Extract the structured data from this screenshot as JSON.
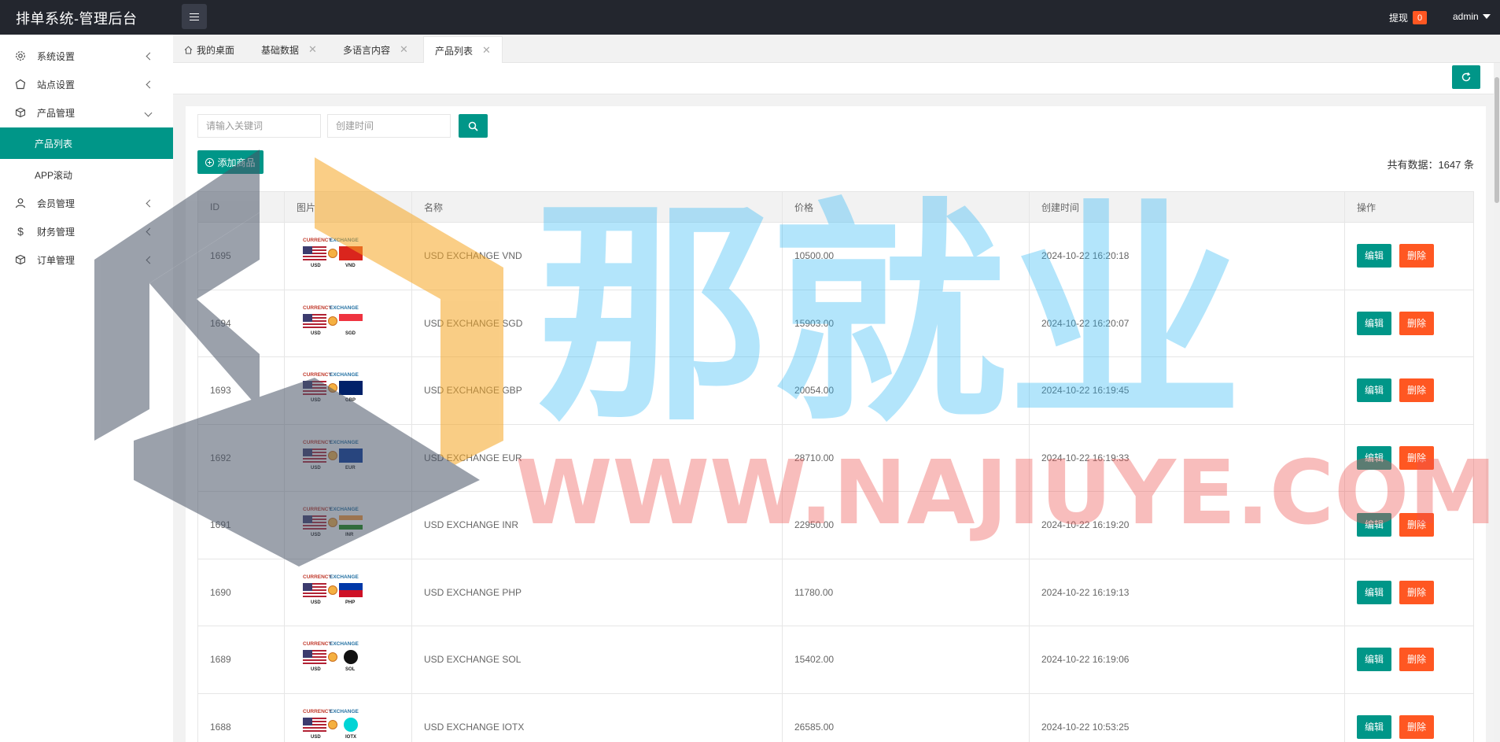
{
  "header": {
    "title": "排单系统-管理后台",
    "withdraw_label": "提现",
    "withdraw_count": "0",
    "user_name": "admin"
  },
  "sidebar": {
    "items": [
      {
        "label": "系统设置",
        "icon": "gear-icon"
      },
      {
        "label": "站点设置",
        "icon": "site-icon"
      },
      {
        "label": "产品管理",
        "icon": "box-icon"
      },
      {
        "label": "会员管理",
        "icon": "user-icon"
      },
      {
        "label": "财务管理",
        "icon": "dollar-icon"
      },
      {
        "label": "订单管理",
        "icon": "order-icon"
      }
    ],
    "sub_items": [
      {
        "label": "产品列表",
        "active": true
      },
      {
        "label": "APP滚动",
        "active": false
      }
    ]
  },
  "tabs": [
    {
      "label": "我的桌面",
      "closable": false
    },
    {
      "label": "基础数据",
      "closable": true
    },
    {
      "label": "多语言内容",
      "closable": true
    },
    {
      "label": "产品列表",
      "closable": true,
      "active": true
    }
  ],
  "filters": {
    "keyword_placeholder": "请输入关键词",
    "date_placeholder": "创建时间"
  },
  "toolbar": {
    "add_label": "添加商品",
    "total_label": "共有数据：1647 条"
  },
  "table": {
    "columns": [
      "ID",
      "图片",
      "名称",
      "价格",
      "创建时间",
      "操作"
    ],
    "edit_label": "编辑",
    "delete_label": "删除",
    "thumb_text_left": "CURRENCY",
    "thumb_text_right": "EXCHANGE",
    "thumb_base": "USD",
    "rows": [
      {
        "id": "1695",
        "name": "USD EXCHANGE VND",
        "price": "10500.00",
        "created": "2024-10-22 16:20:18",
        "cur": "VND"
      },
      {
        "id": "1694",
        "name": "USD EXCHANGE SGD",
        "price": "15903.00",
        "created": "2024-10-22 16:20:07",
        "cur": "SGD"
      },
      {
        "id": "1693",
        "name": "USD EXCHANGE GBP",
        "price": "20054.00",
        "created": "2024-10-22 16:19:45",
        "cur": "GBP"
      },
      {
        "id": "1692",
        "name": "USD EXCHANGE EUR",
        "price": "28710.00",
        "created": "2024-10-22 16:19:33",
        "cur": "EUR"
      },
      {
        "id": "1691",
        "name": "USD EXCHANGE INR",
        "price": "22950.00",
        "created": "2024-10-22 16:19:20",
        "cur": "INR"
      },
      {
        "id": "1690",
        "name": "USD EXCHANGE PHP",
        "price": "11780.00",
        "created": "2024-10-22 16:19:13",
        "cur": "PHP"
      },
      {
        "id": "1689",
        "name": "USD EXCHANGE SOL",
        "price": "15402.00",
        "created": "2024-10-22 16:19:06",
        "cur": "SOL"
      },
      {
        "id": "1688",
        "name": "USD EXCHANGE IOTX",
        "price": "26585.00",
        "created": "2024-10-22 10:53:25",
        "cur": "IOTX"
      }
    ]
  },
  "watermark": {
    "cn_text": "那就业",
    "url_text": "WWW.NAJIUYE.COM"
  },
  "colors": {
    "accent": "#009688",
    "danger": "#ff5722",
    "topbar": "#23262e"
  }
}
